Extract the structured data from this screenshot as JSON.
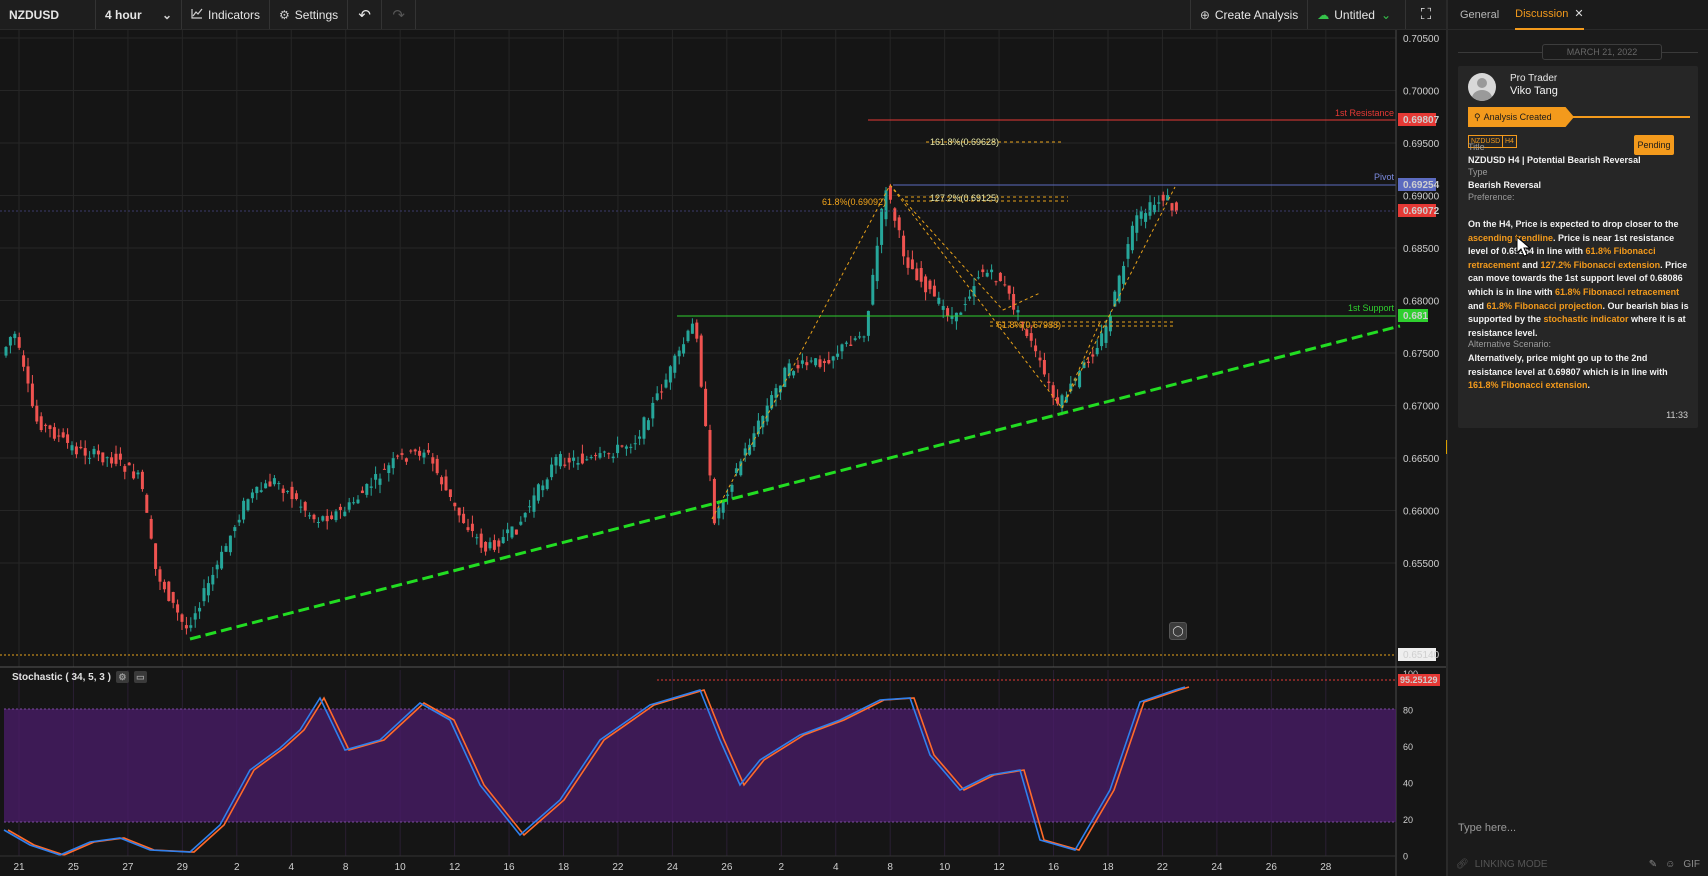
{
  "toolbar": {
    "symbol": "NZDUSD",
    "interval": "4 hour",
    "indicators": "Indicators",
    "settings": "Settings",
    "create_analysis": "Create Analysis",
    "untitled": "Untitled",
    "icons": {
      "indicators": "chart-line-icon",
      "settings": "gear-icon",
      "undo": "undo-icon",
      "redo": "redo-icon",
      "create": "plus-circle-icon",
      "cloud": "cloud-check-icon",
      "fullscreen": "fullscreen-icon"
    }
  },
  "chart": {
    "price_ticks": [
      "0.70500",
      "0.70000",
      "0.69500",
      "0.69000",
      "0.68500",
      "0.68000",
      "0.67500",
      "0.67000",
      "0.66500",
      "0.66000",
      "0.65500"
    ],
    "date_ticks": [
      "21",
      "25",
      "27",
      "29",
      "2",
      "4",
      "8",
      "10",
      "12",
      "16",
      "18",
      "22",
      "24",
      "26",
      "2",
      "4",
      "8",
      "10",
      "12",
      "16",
      "18",
      "22",
      "24",
      "26",
      "28"
    ],
    "levels": {
      "resistance": {
        "label": "1st Resistance",
        "price": "0.69807",
        "color": "#e53935"
      },
      "pivot": {
        "label": "Pivot",
        "price": "0.69254",
        "color": "#5c6bc0"
      },
      "support": {
        "label": "1st Support",
        "price": "0.681",
        "color": "#2fcf2f"
      },
      "current": {
        "price": "0.69072",
        "color": "#e53935"
      },
      "low": {
        "price": "0.65140"
      }
    },
    "fib_labels": {
      "ext_1618": "161.8%(0.69628)",
      "ext_1272": "127.2%(0.69125)",
      "ret_618_top": "61.8%(0.69092)",
      "ret_618_mid": "61.8%(0.67988)"
    },
    "colors": {
      "up": "#26a69a",
      "down": "#ef5350",
      "trendline": "#22dd22",
      "fib": "#e8a21a"
    }
  },
  "stochastic": {
    "title": "Stochastic ( 34, 5, 3 )",
    "ticks": [
      "100",
      "80",
      "60",
      "40",
      "20",
      "0"
    ],
    "value": "95.25129",
    "line_colors": {
      "k": "#2f80ed",
      "d": "#ff6a2a"
    },
    "band_color": "#4b1c6b",
    "icons": {
      "settings": "gear-icon",
      "delete": "trash-icon"
    }
  },
  "side_panel": {
    "tabs": {
      "general": "General",
      "discussion": "Discussion"
    },
    "date_divider": "MARCH 21, 2022",
    "post": {
      "role": "Pro Trader",
      "name": "Viko Tang",
      "banner": "Analysis Created",
      "tags": [
        "NZDUSD",
        "H4"
      ],
      "status": "Pending",
      "title_label": "Title",
      "title": "NZDUSD H4 | Potential Bearish Reversal",
      "type_label": "Type",
      "type": "Bearish Reversal",
      "preference_label": "Preference:",
      "preference": {
        "p1": "On the H4, Price is expected to drop closer to the ",
        "h1": "ascending trendline",
        "p2": ". Price is near 1st resistance level of 0.69254 in line with ",
        "h2": "61.8% Fibonacci retracement",
        "p3": " and ",
        "h3": "127.2% Fibonacci extension",
        "p4": ". Price can move towards the 1st support level of 0.68086 which is in line with ",
        "h4": "61.8% Fibonacci retracement",
        "p5": " and ",
        "h5": "61.8% Fibonacci projection",
        "p6": ". Our bearish bias is supported by the ",
        "h6": "stochastic indicator",
        "p7": " where it is at resistance level."
      },
      "alt_label": "Alternative Scenario:",
      "alt": {
        "p1": "Alternatively, price might go up to the 2nd resistance level at 0.69807 which is in line with ",
        "h1": "161.8% Fibonacci extension",
        "p2": "."
      },
      "time": "11:33"
    },
    "composer_placeholder": "Type here...",
    "linking_mode": "LINKING MODE",
    "gif": "GIF"
  }
}
